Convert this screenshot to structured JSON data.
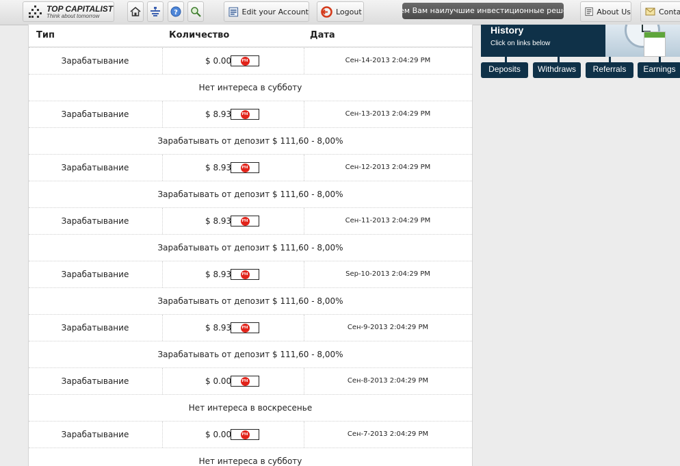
{
  "topbar": {
    "logo_name": "TOP CAPITALIST",
    "logo_tagline": "Think about tomorrow",
    "edit_account": "Edit your Account",
    "logout": "Logout",
    "ticker": "ем Вам наилучшие инвестиционные решения и",
    "about": "About Us",
    "contact": "Contac"
  },
  "table": {
    "headers": {
      "type": "Тип",
      "amount": "Количество",
      "date": "Дата"
    },
    "pm_badge": "PM",
    "rows": [
      {
        "type": "Зарабатывание",
        "amount": "$ 0.00",
        "date": "Сен-14-2013 2:04:29 PM",
        "note": "Нет интереса в субботу"
      },
      {
        "type": "Зарабатывание",
        "amount": "$ 8.93",
        "date": "Сен-13-2013 2:04:29 PM",
        "note": "Зарабатывать от депозит $ 111,60 - 8,00%"
      },
      {
        "type": "Зарабатывание",
        "amount": "$ 8.93",
        "date": "Сен-12-2013 2:04:29 PM",
        "note": "Зарабатывать от депозит $ 111,60 - 8,00%"
      },
      {
        "type": "Зарабатывание",
        "amount": "$ 8.93",
        "date": "Сен-11-2013 2:04:29 PM",
        "note": "Зарабатывать от депозит $ 111,60 - 8,00%"
      },
      {
        "type": "Зарабатывание",
        "amount": "$ 8.93",
        "date": "Sep-10-2013 2:04:29 PM",
        "note": "Зарабатывать от депозит $ 111,60 - 8,00%"
      },
      {
        "type": "Зарабатывание",
        "amount": "$ 8.93",
        "date": "Сен-9-2013 2:04:29 PM",
        "note": "Зарабатывать от депозит $ 111,60 - 8,00%"
      },
      {
        "type": "Зарабатывание",
        "amount": "$ 0.00",
        "date": "Сен-8-2013 2:04:29 PM",
        "note": "Нет интереса в воскресенье"
      },
      {
        "type": "Зарабатывание",
        "amount": "$ 0.00",
        "date": "Сен-7-2013 2:04:29 PM",
        "note": "Нет интереса в субботу"
      }
    ]
  },
  "history": {
    "title": "History",
    "subtitle": "Click on links below",
    "tabs": [
      "Deposits",
      "Withdraws",
      "Referrals",
      "Earnings"
    ]
  }
}
